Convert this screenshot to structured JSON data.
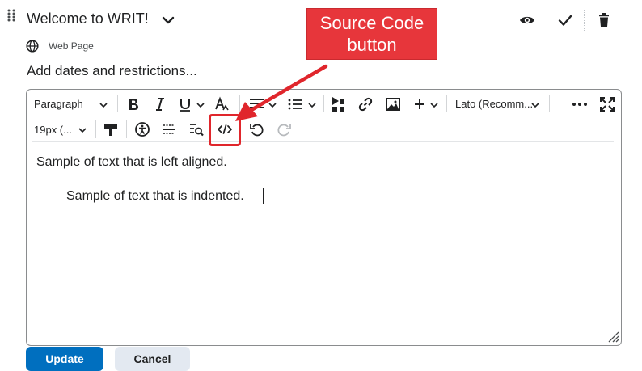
{
  "header": {
    "title": "Welcome to WRIT!",
    "type_label": "Web Page",
    "dates_link": "Add dates and restrictions..."
  },
  "toolbar": {
    "format_select": "Paragraph",
    "font_select": "Lato (Recomm...",
    "size_select": "19px (...",
    "icons": [
      "bold-icon",
      "italic-icon",
      "underline-icon",
      "text-format-icon",
      "align-icon",
      "list-icon",
      "insert-element-icon",
      "link-icon",
      "image-icon",
      "plus-icon",
      "more-icon",
      "fullscreen-icon",
      "format-painter-icon",
      "accessibility-icon",
      "horizontal-rule-icon",
      "preview-icon",
      "source-code-icon",
      "undo-icon",
      "redo-icon"
    ]
  },
  "content": {
    "line1": "Sample of text that is left aligned.",
    "line2": "Sample of text that is indented."
  },
  "buttons": {
    "primary": "Update",
    "secondary": "Cancel"
  },
  "annotation": {
    "callout_line1": "Source Code",
    "callout_line2": "button"
  },
  "colors": {
    "accent": "#006fbf",
    "annotation": "#e7363b"
  }
}
